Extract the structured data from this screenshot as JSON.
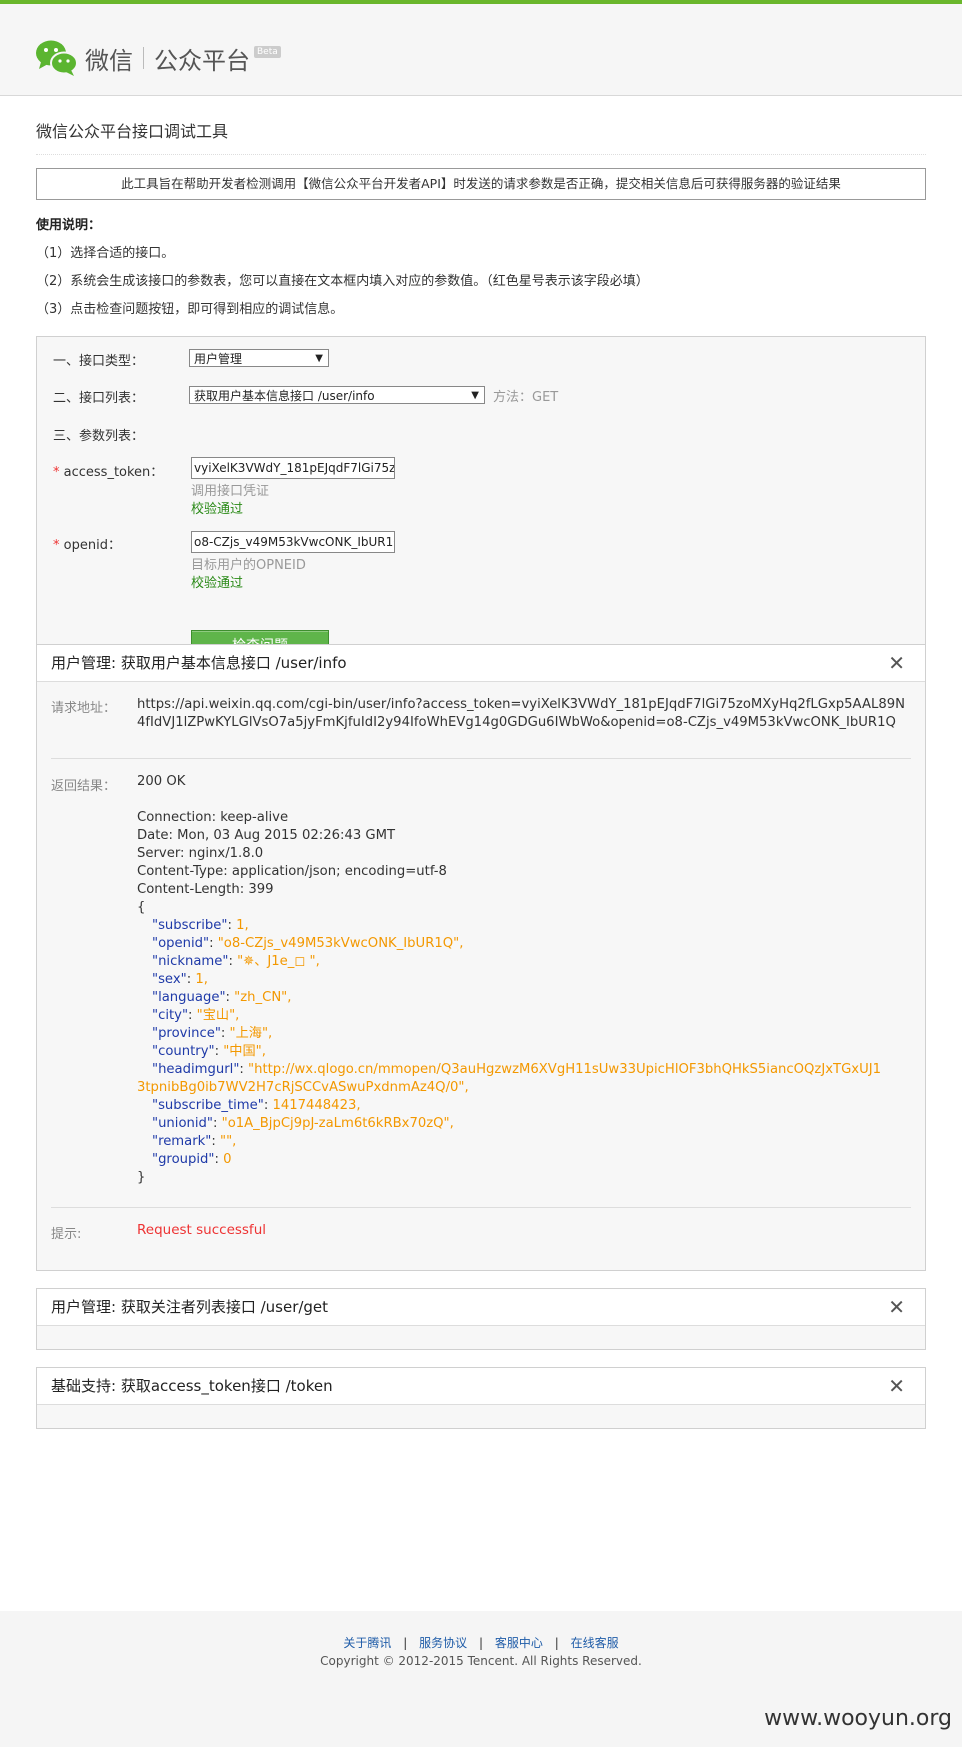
{
  "header": {
    "brand_name": "微信",
    "brand_sub": "公众平台",
    "beta": "Beta"
  },
  "page_title": "微信公众平台接口调试工具",
  "notice": "此工具旨在帮助开发者检测调用【微信公众平台开发者API】时发送的请求参数是否正确，提交相关信息后可获得服务器的验证结果",
  "usage": {
    "title": "使用说明：",
    "steps": [
      "（1）选择合适的接口。",
      "（2）系统会生成该接口的参数表，您可以直接在文本框内填入对应的参数值。（红色星号表示该字段必填）",
      "（3）点击检查问题按钮，即可得到相应的调试信息。"
    ]
  },
  "form": {
    "type_label": "一、接口类型：",
    "type_value": "用户管理",
    "list_label": "二、接口列表：",
    "list_value": "获取用户基本信息接口 /user/info",
    "method": "方法：GET",
    "params_label": "三、参数列表：",
    "required_mark": "*",
    "access_token_label": "access_token：",
    "access_token_value": "vyiXelK3VWdY_181pEJqdF7lGi75z",
    "access_token_hint": "调用接口凭证",
    "access_token_ok": "校验通过",
    "openid_label": "openid：",
    "openid_value": "o8-CZjs_v49M53kVwcONK_IbUR1Q",
    "openid_hint": "目标用户的OPNEID",
    "openid_ok": "校验通过",
    "check_button": "检查问题"
  },
  "result_panel": {
    "title": "用户管理: 获取用户基本信息接口 /user/info",
    "close": "✕",
    "request_label": "请求地址：",
    "request_url": "https://api.weixin.qq.com/cgi-bin/user/info?access_token=vyiXelK3VWdY_181pEJqdF7lGi75zoMXyHq2fLGxp5AAL89N4fIdVJ1lZPwKYLGlVsO7a5jyFmKjfuIdI2y94IfoWhEVg14g0GDGu6IWbWo&openid=o8-CZjs_v49M53kVwcONK_IbUR1Q",
    "response_label": "返回结果：",
    "status": "200 OK",
    "headers": [
      "Connection: keep-alive",
      "Date: Mon, 03 Aug 2015 02:26:43 GMT",
      "Server: nginx/1.8.0",
      "Content-Type: application/json; encoding=utf-8",
      "Content-Length: 399"
    ],
    "brace_open": "{",
    "brace_close": "}",
    "json": {
      "subscribe_k": "\"subscribe\"",
      "subscribe_v": "1,",
      "openid_k": "\"openid\"",
      "openid_v": "\"o8-CZjs_v49M53kVwcONK_IbUR1Q\",",
      "nickname_k": "\"nickname\"",
      "nickname_v": "\"✵、J1e_◻ \",",
      "sex_k": "\"sex\"",
      "sex_v": "1,",
      "language_k": "\"language\"",
      "language_v": "\"zh_CN\",",
      "city_k": "\"city\"",
      "city_v": "\"宝山\",",
      "province_k": "\"province\"",
      "province_v": "\"上海\",",
      "country_k": "\"country\"",
      "country_v": "\"中国\",",
      "headimgurl_k": "\"headimgurl\"",
      "headimgurl_v1": "\"http://wx.qlogo.cn/mmopen/Q3auHgzwzM6XVgH11sUw33UpicHlOF3bhQHkS5iancOQzJxTGxUJ1",
      "headimgurl_v2": "3tpnibBg0ib7WV2H7cRjSCCvASwuPxdnmAz4Q/0\",",
      "subscribe_time_k": "\"subscribe_time\"",
      "subscribe_time_v": "1417448423,",
      "unionid_k": "\"unionid\"",
      "unionid_v": "\"o1A_BjpCj9pJ-zaLm6t6kRBx70zQ\",",
      "remark_k": "\"remark\"",
      "remark_v": "\"\",",
      "groupid_k": "\"groupid\"",
      "groupid_v": "0"
    },
    "tip_label": "提示:",
    "tip_value": "Request successful"
  },
  "panel2": {
    "title": "用户管理: 获取关注者列表接口 /user/get",
    "close": "✕"
  },
  "panel3": {
    "title": "基础支持: 获取access_token接口 /token",
    "close": "✕"
  },
  "footer": {
    "links": [
      "关于腾讯",
      "服务协议",
      "客服中心",
      "在线客服"
    ],
    "sep": "|",
    "copyright": "Copyright © 2012-2015 Tencent. All Rights Reserved."
  },
  "watermark": "www.wooyun.org",
  "colors": {
    "brand_green": "#6ab72c",
    "button_green": "#5fb54a",
    "json_key": "#1f3aa8",
    "json_value": "#f39800",
    "error_red": "#e33333"
  }
}
